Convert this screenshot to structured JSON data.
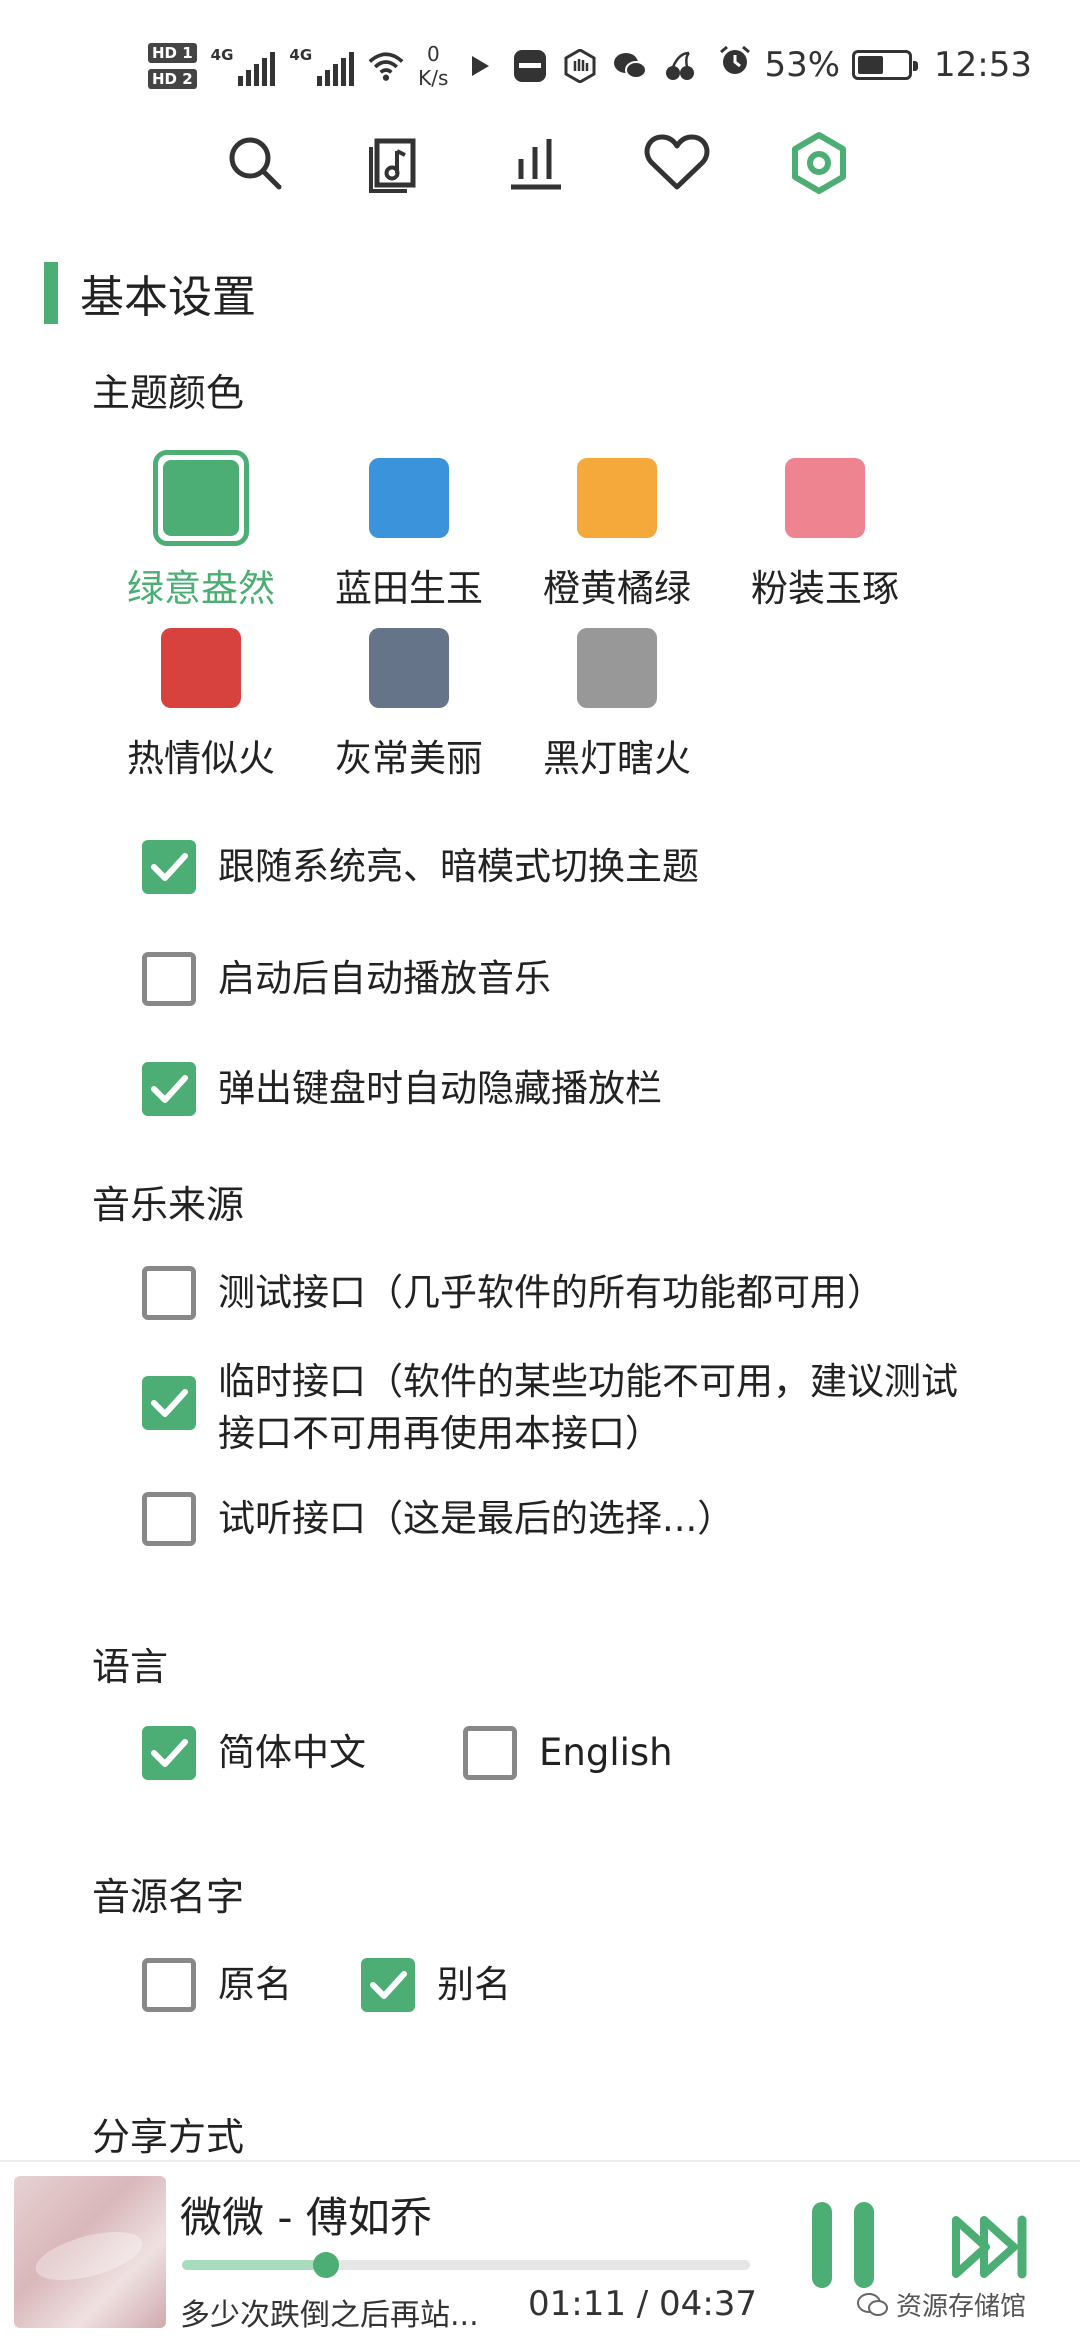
{
  "status_bar": {
    "hd1": "HD 1",
    "hd2": "HD 2",
    "net1": "4G",
    "net2": "4G",
    "speed_value": "0",
    "speed_unit": "K/s",
    "battery_percent": "53%",
    "battery_level": 0.53,
    "time": "12:53",
    "icons": [
      "play-icon",
      "huawei-icon",
      "hand-icon",
      "wechat-icon",
      "cherry-icon",
      "alarm-icon",
      "battery-icon",
      "wifi-icon",
      "signal-icon"
    ]
  },
  "nav": {
    "items": [
      "search-icon",
      "music-library-icon",
      "chart-icon",
      "heart-icon",
      "settings-icon"
    ],
    "active": "settings-icon"
  },
  "section_title": "基本设置",
  "theme": {
    "label": "主题颜色",
    "swatches": [
      {
        "name": "绿意盎然",
        "color": "#4cae74",
        "selected": true
      },
      {
        "name": "蓝田生玉",
        "color": "#3b93dc"
      },
      {
        "name": "橙黄橘绿",
        "color": "#f4a93a"
      },
      {
        "name": "粉装玉琢",
        "color": "#ef8491"
      },
      {
        "name": "热情似火",
        "color": "#d7423f"
      },
      {
        "name": "灰常美丽",
        "color": "#66748a"
      },
      {
        "name": "黑灯瞎火",
        "color": "#989898"
      }
    ]
  },
  "options": {
    "follow_system": {
      "label": "跟随系统亮、暗模式切换主题",
      "checked": true
    },
    "autoplay": {
      "label": "启动后自动播放音乐",
      "checked": false
    },
    "hide_bar": {
      "label": "弹出键盘时自动隐藏播放栏",
      "checked": true
    }
  },
  "music_source": {
    "label": "音乐来源",
    "items": [
      {
        "label": "测试接口（几乎软件的所有功能都可用）",
        "checked": false
      },
      {
        "label": "临时接口（软件的某些功能不可用，建议测试接口不可用再使用本接口）",
        "checked": true
      },
      {
        "label": "试听接口（这是最后的选择...）",
        "checked": false
      }
    ]
  },
  "language": {
    "label": "语言",
    "items": [
      {
        "label": "简体中文",
        "checked": true
      },
      {
        "label": "English",
        "checked": false
      }
    ]
  },
  "source_name": {
    "label": "音源名字",
    "items": [
      {
        "label": "原名",
        "checked": false
      },
      {
        "label": "别名",
        "checked": true
      }
    ]
  },
  "share": {
    "label": "分享方式"
  },
  "player": {
    "title": "微微 - 傅如乔",
    "lyric": "多少次跌倒之后再站...",
    "time": "01:11 / 04:37",
    "progress": 0.254,
    "watermark": "资源存储馆"
  },
  "accent_color": "#4cae74"
}
